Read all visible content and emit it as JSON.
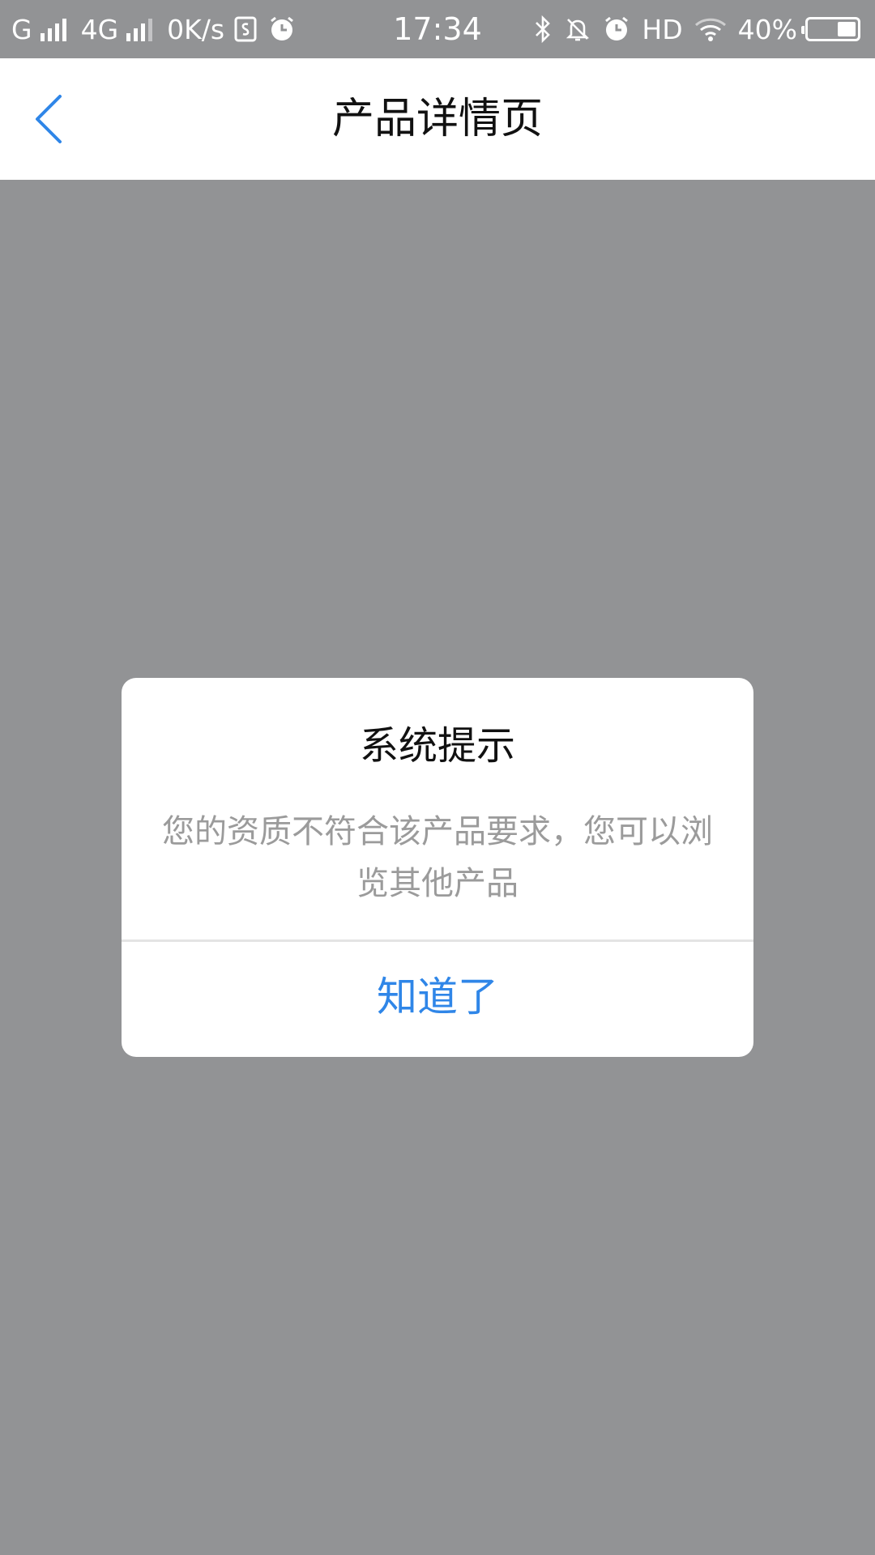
{
  "status_bar": {
    "carrier1": "G",
    "carrier2": "4G",
    "network_speed": "0K/s",
    "time": "17:34",
    "hd": "HD",
    "battery_percent": "40%",
    "battery_level": 0.4
  },
  "nav": {
    "title": "产品详情页"
  },
  "dialog": {
    "title": "系统提示",
    "message": "您的资质不符合该产品要求，您可以浏览其他产品",
    "button_label": "知道了"
  },
  "colors": {
    "accent": "#2f86e8",
    "overlay": "#929395"
  }
}
